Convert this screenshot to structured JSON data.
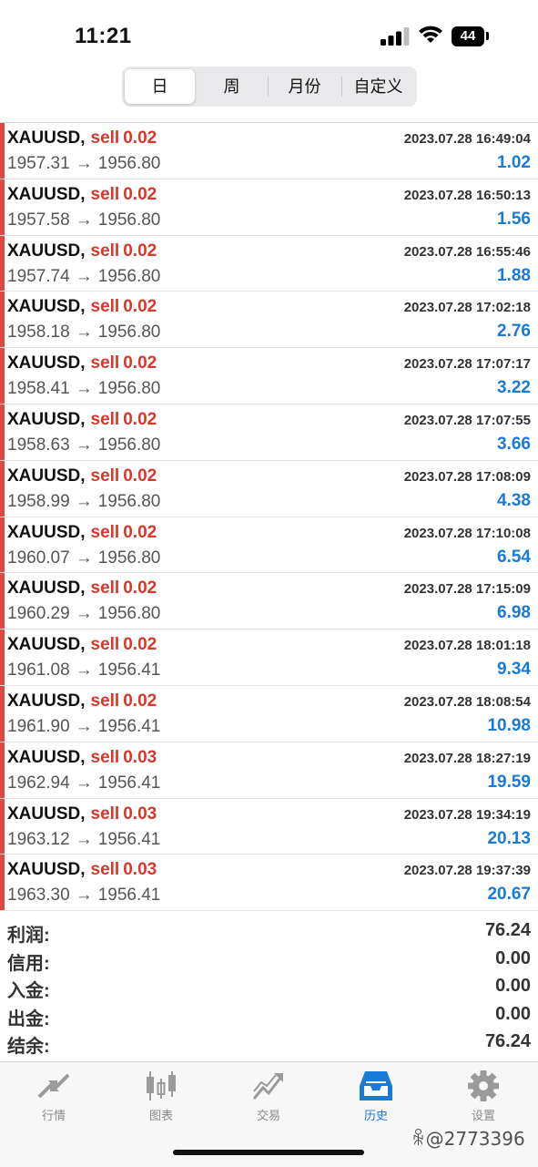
{
  "status_bar": {
    "time": "11:21",
    "battery": "44"
  },
  "periods": [
    "日",
    "周",
    "月份",
    "自定义"
  ],
  "active_period": 0,
  "trades": [
    {
      "symbol": "XAUUSD,",
      "side": "sell",
      "volume": "0.02",
      "time": "2023.07.28 16:49:04",
      "open": "1957.31",
      "arrow": "→",
      "close": "1956.80",
      "profit": "1.02"
    },
    {
      "symbol": "XAUUSD,",
      "side": "sell",
      "volume": "0.02",
      "time": "2023.07.28 16:50:13",
      "open": "1957.58",
      "arrow": "→",
      "close": "1956.80",
      "profit": "1.56"
    },
    {
      "symbol": "XAUUSD,",
      "side": "sell",
      "volume": "0.02",
      "time": "2023.07.28 16:55:46",
      "open": "1957.74",
      "arrow": "→",
      "close": "1956.80",
      "profit": "1.88"
    },
    {
      "symbol": "XAUUSD,",
      "side": "sell",
      "volume": "0.02",
      "time": "2023.07.28 17:02:18",
      "open": "1958.18",
      "arrow": "→",
      "close": "1956.80",
      "profit": "2.76"
    },
    {
      "symbol": "XAUUSD,",
      "side": "sell",
      "volume": "0.02",
      "time": "2023.07.28 17:07:17",
      "open": "1958.41",
      "arrow": "→",
      "close": "1956.80",
      "profit": "3.22"
    },
    {
      "symbol": "XAUUSD,",
      "side": "sell",
      "volume": "0.02",
      "time": "2023.07.28 17:07:55",
      "open": "1958.63",
      "arrow": "→",
      "close": "1956.80",
      "profit": "3.66"
    },
    {
      "symbol": "XAUUSD,",
      "side": "sell",
      "volume": "0.02",
      "time": "2023.07.28 17:08:09",
      "open": "1958.99",
      "arrow": "→",
      "close": "1956.80",
      "profit": "4.38"
    },
    {
      "symbol": "XAUUSD,",
      "side": "sell",
      "volume": "0.02",
      "time": "2023.07.28 17:10:08",
      "open": "1960.07",
      "arrow": "→",
      "close": "1956.80",
      "profit": "6.54"
    },
    {
      "symbol": "XAUUSD,",
      "side": "sell",
      "volume": "0.02",
      "time": "2023.07.28 17:15:09",
      "open": "1960.29",
      "arrow": "→",
      "close": "1956.80",
      "profit": "6.98"
    },
    {
      "symbol": "XAUUSD,",
      "side": "sell",
      "volume": "0.02",
      "time": "2023.07.28 18:01:18",
      "open": "1961.08",
      "arrow": "→",
      "close": "1956.41",
      "profit": "9.34"
    },
    {
      "symbol": "XAUUSD,",
      "side": "sell",
      "volume": "0.02",
      "time": "2023.07.28 18:08:54",
      "open": "1961.90",
      "arrow": "→",
      "close": "1956.41",
      "profit": "10.98"
    },
    {
      "symbol": "XAUUSD,",
      "side": "sell",
      "volume": "0.03",
      "time": "2023.07.28 18:27:19",
      "open": "1962.94",
      "arrow": "→",
      "close": "1956.41",
      "profit": "19.59"
    },
    {
      "symbol": "XAUUSD,",
      "side": "sell",
      "volume": "0.03",
      "time": "2023.07.28 19:34:19",
      "open": "1963.12",
      "arrow": "→",
      "close": "1956.41",
      "profit": "20.13"
    },
    {
      "symbol": "XAUUSD,",
      "side": "sell",
      "volume": "0.03",
      "time": "2023.07.28 19:37:39",
      "open": "1963.30",
      "arrow": "→",
      "close": "1956.41",
      "profit": "20.67"
    }
  ],
  "summary": [
    {
      "label": "利润:",
      "value": "76.24"
    },
    {
      "label": "信用:",
      "value": "0.00"
    },
    {
      "label": "入金:",
      "value": "0.00"
    },
    {
      "label": "出金:",
      "value": "0.00"
    },
    {
      "label": "结余:",
      "value": "76.24"
    }
  ],
  "tabs": [
    {
      "label": "行情",
      "icon": "quotes-icon"
    },
    {
      "label": "图表",
      "icon": "chart-icon"
    },
    {
      "label": "交易",
      "icon": "trade-icon"
    },
    {
      "label": "历史",
      "icon": "history-icon"
    },
    {
      "label": "设置",
      "icon": "settings-icon"
    }
  ],
  "active_tab": 3,
  "colors": {
    "sell": "#d8372b",
    "profit": "#1a7ad9",
    "bar": "#e0483d",
    "tab_active": "#1a7ad9",
    "tab_inactive": "#8a8a8a"
  },
  "watermark": "ꆜ@2773396"
}
